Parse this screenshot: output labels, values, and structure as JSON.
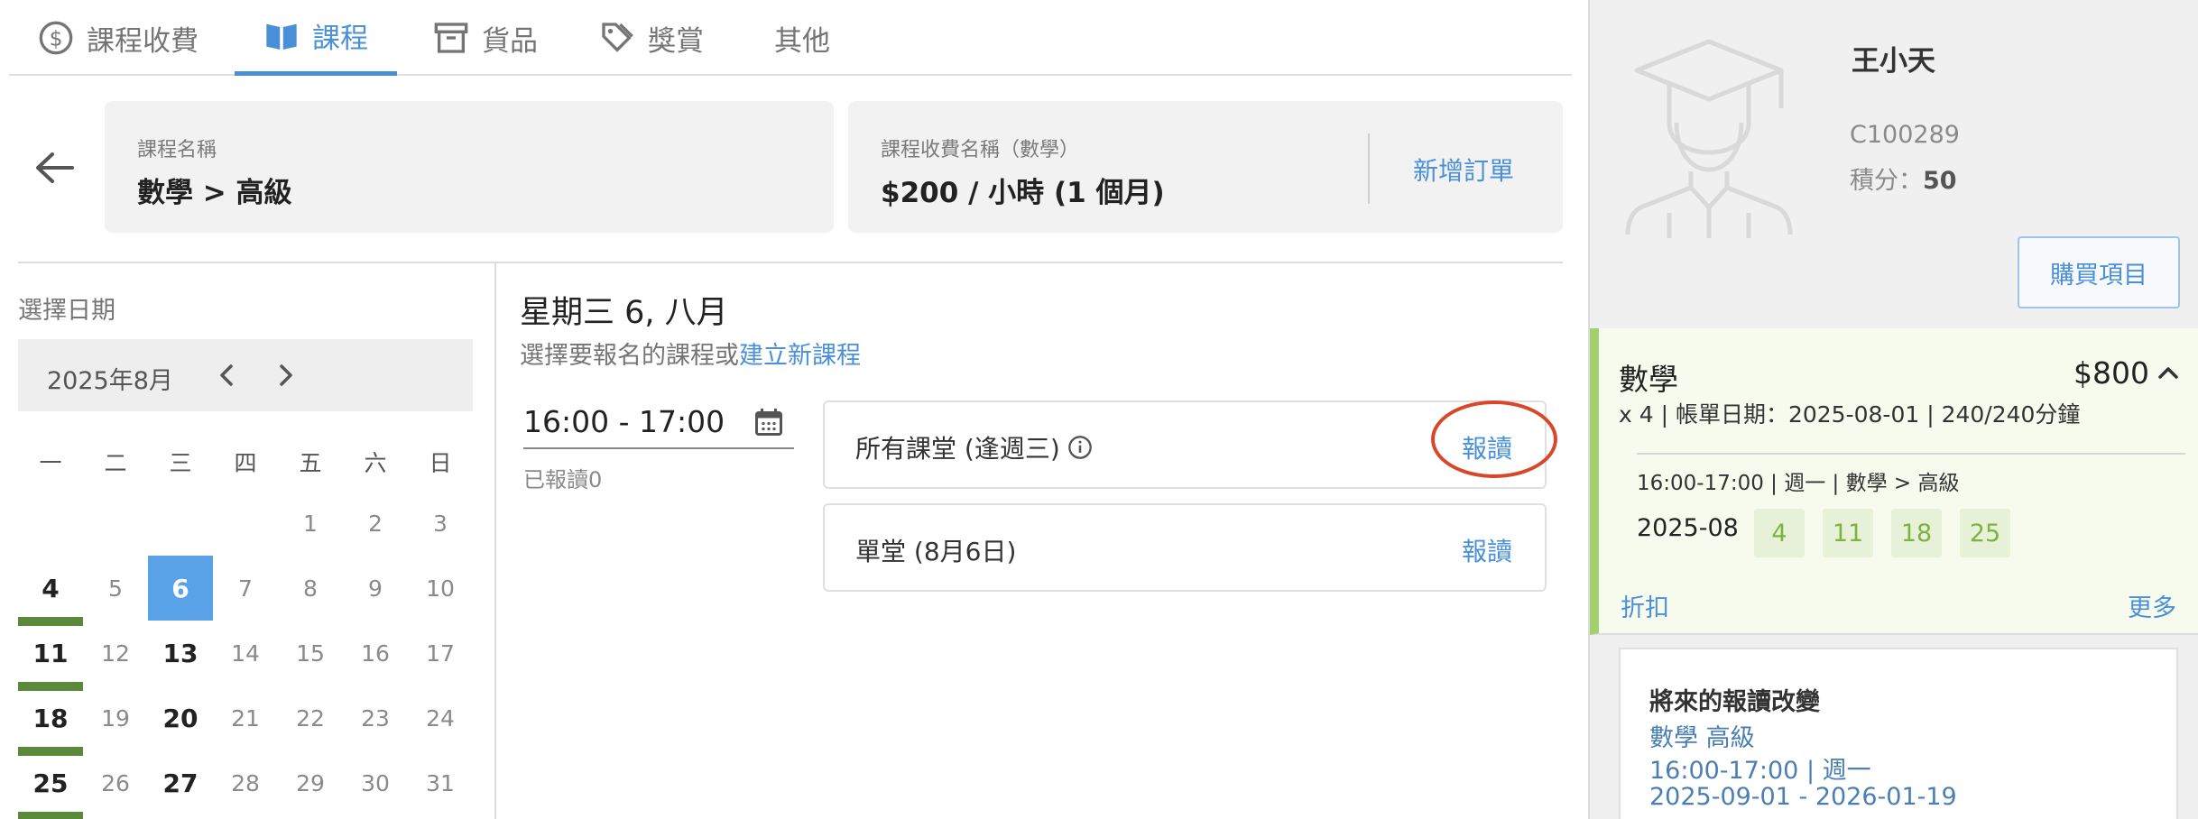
{
  "tabs": [
    {
      "label": "課程收費",
      "icon": "dollar-circle-icon"
    },
    {
      "label": "課程",
      "icon": "open-book-icon"
    },
    {
      "label": "貨品",
      "icon": "archive-box-icon"
    },
    {
      "label": "獎賞",
      "icon": "tags-icon"
    },
    {
      "label": "其他",
      "icon": ""
    }
  ],
  "course": {
    "name_label": "課程名稱",
    "name_value": "數學 > 高級",
    "fee_label": "課程收費名稱（數學）",
    "fee_value": "$200 / 小時 (1 個月)",
    "new_order": "新增訂單"
  },
  "calendar": {
    "title": "選擇日期",
    "month_label": "2025年8月",
    "weekdays": [
      "一",
      "二",
      "三",
      "四",
      "五",
      "六",
      "日"
    ],
    "weeks": [
      [
        "",
        "",
        "",
        "",
        "1",
        "2",
        "3"
      ],
      [
        "4",
        "5",
        "6",
        "7",
        "8",
        "9",
        "10"
      ],
      [
        "11",
        "12",
        "13",
        "14",
        "15",
        "16",
        "17"
      ],
      [
        "18",
        "19",
        "20",
        "21",
        "22",
        "23",
        "24"
      ],
      [
        "25",
        "26",
        "27",
        "28",
        "29",
        "30",
        "31"
      ]
    ],
    "selected_day": "6",
    "bold_days": [
      "4",
      "11",
      "13",
      "18",
      "20",
      "25",
      "27"
    ],
    "marked_days": [
      "4",
      "11",
      "18",
      "25"
    ]
  },
  "session": {
    "date_title": "星期三 6, 八月",
    "subtitle_prefix": "選擇要報名的課程或",
    "create_link": "建立新課程",
    "time_range": "16:00 - 17:00",
    "enrolled": "已報讀0",
    "options": [
      {
        "label": "所有課堂 (逢週三)",
        "action": "報讀",
        "info_icon": "info-circle-icon"
      },
      {
        "label": "單堂 (8月6日)",
        "action": "報讀"
      }
    ]
  },
  "student": {
    "name": "王小天",
    "id": "C100289",
    "points_label": "積分：",
    "points_value": "50",
    "buy_button": "購買項目",
    "avatar_icon": "graduate-avatar-icon"
  },
  "order": {
    "subject": "數學",
    "price": "$800",
    "meta": "x 4 | 帳單日期：2025-08-01 | 240/240分鐘",
    "schedule": "16:00-17:00 | 週一 | 數學 > 高級",
    "month": "2025-08",
    "days": [
      "4",
      "11",
      "18",
      "25"
    ],
    "discount": "折扣",
    "more": "更多"
  },
  "future": {
    "title": "將來的報讀改變",
    "lines": [
      "數學 高級",
      "16:00-17:00 | 週一",
      "2025-09-01 - 2026-01-19"
    ]
  },
  "colors": {
    "accent": "#4a90d9",
    "selected_day": "#5aa2e8",
    "marker": "#5b8a3a",
    "highlight_circle": "#d9472b",
    "order_bg": "#f7fbee",
    "order_border": "#a3d06c"
  }
}
